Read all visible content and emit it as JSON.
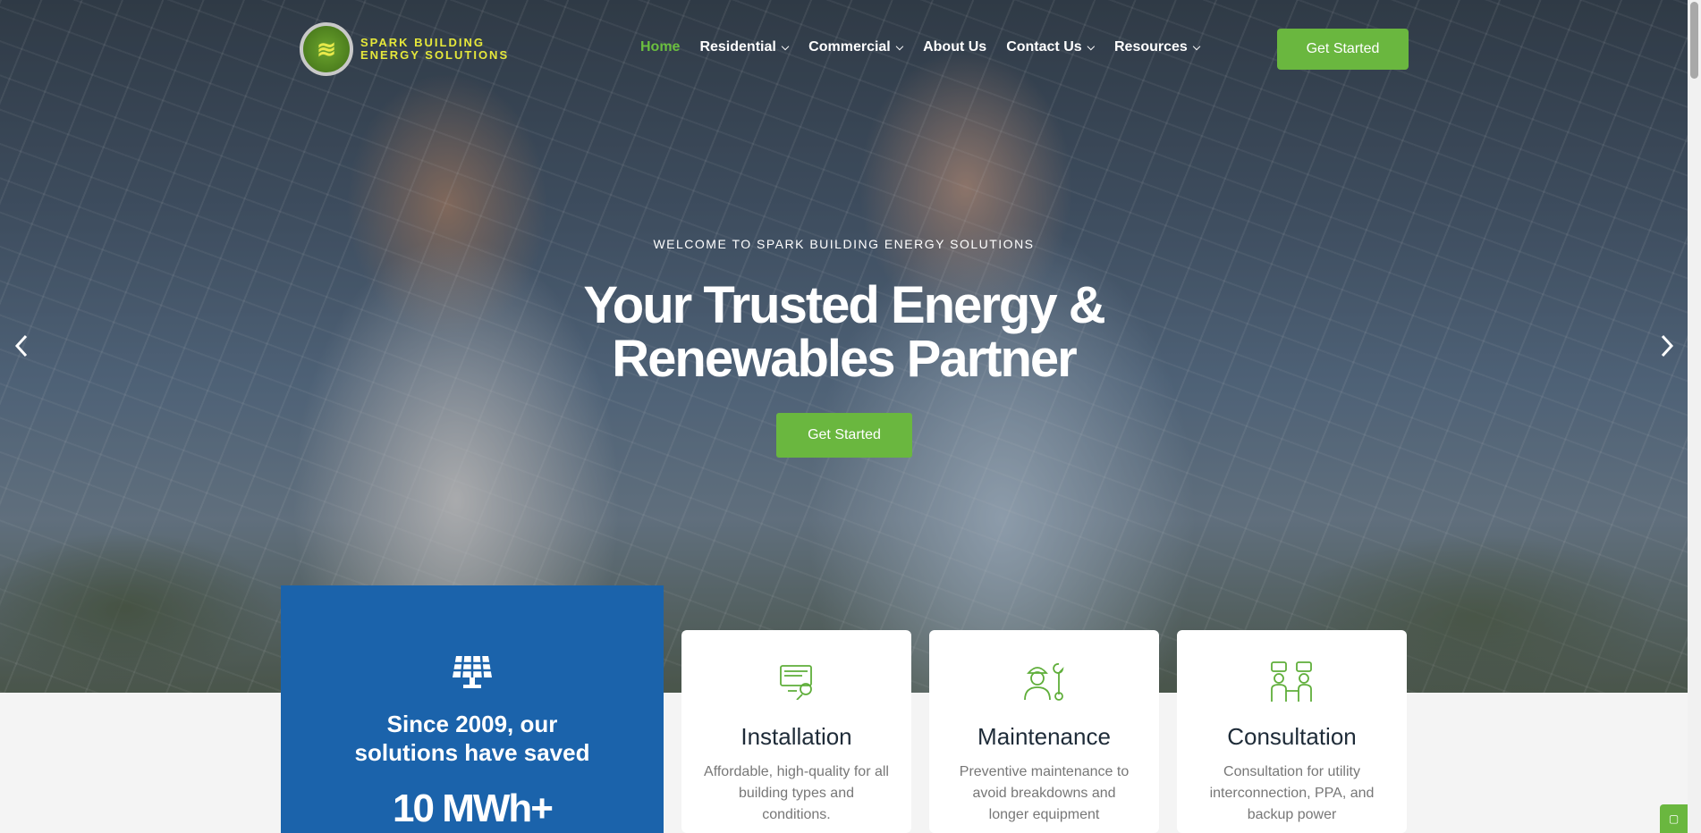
{
  "brand": {
    "line1": "SPARK BUILDING",
    "line2": "ENERGY SOLUTIONS"
  },
  "nav": {
    "items": [
      {
        "label": "Home",
        "active": true,
        "dropdown": false
      },
      {
        "label": "Residential",
        "active": false,
        "dropdown": true
      },
      {
        "label": "Commercial",
        "active": false,
        "dropdown": true
      },
      {
        "label": "About Us",
        "active": false,
        "dropdown": false
      },
      {
        "label": "Contact Us",
        "active": false,
        "dropdown": true
      },
      {
        "label": "Resources",
        "active": false,
        "dropdown": true
      }
    ],
    "cta": "Get Started"
  },
  "hero": {
    "eyebrow": "WELCOME TO SPARK BUILDING ENERGY SOLUTIONS",
    "headline": "Your Trusted Energy & Renewables Partner",
    "cta": "Get Started",
    "prev_icon": "chevron-left-icon",
    "next_icon": "chevron-right-icon"
  },
  "stat": {
    "text": "Since 2009, our solutions have saved",
    "value": "10 MWh+",
    "icon": "solar-panel-icon"
  },
  "services": [
    {
      "title": "Installation",
      "desc": "Affordable, high-quality for all building types and conditions.",
      "icon": "installation-icon"
    },
    {
      "title": "Maintenance",
      "desc": "Preventive maintenance to avoid breakdowns and longer equipment",
      "icon": "maintenance-worker-icon"
    },
    {
      "title": "Consultation",
      "desc": "Consultation for utility interconnection, PPA, and backup power",
      "icon": "consultation-icon"
    }
  ],
  "colors": {
    "accent_green": "#6ab73f",
    "stat_blue": "#1b63ab",
    "logo_yellow": "#e6e83a"
  }
}
